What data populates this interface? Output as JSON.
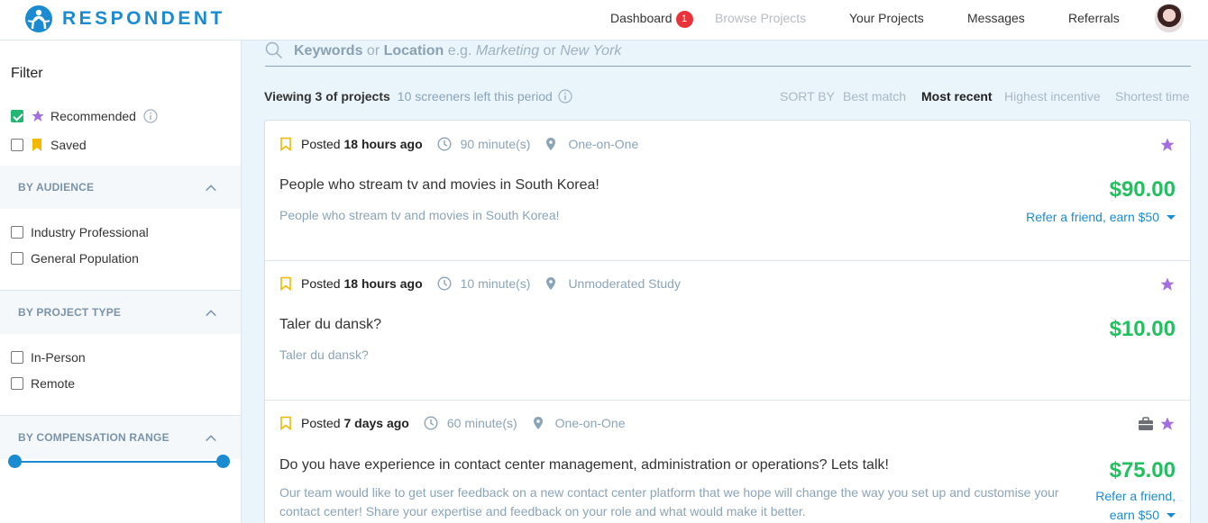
{
  "brand": {
    "name": "RESPONDENT"
  },
  "nav": {
    "dashboard": "Dashboard",
    "dashboard_badge": "1",
    "browse": "Browse Projects",
    "your_projects": "Your Projects",
    "messages": "Messages",
    "referrals": "Referrals"
  },
  "sidebar": {
    "filter_title": "Filter",
    "recommended": "Recommended",
    "saved": "Saved",
    "by_audience": "BY AUDIENCE",
    "industry_professional": "Industry Professional",
    "general_population": "General Population",
    "by_project_type": "BY PROJECT TYPE",
    "in_person": "In-Person",
    "remote": "Remote",
    "by_compensation": "BY COMPENSATION RANGE"
  },
  "search": {
    "kw": "Keywords",
    "or1": " or ",
    "loc": "Location",
    "eg": " e.g. ",
    "ex1": "Marketing",
    "or2": " or ",
    "ex2": "New York"
  },
  "listing": {
    "viewing": "Viewing 3 of projects",
    "screeners": "10 screeners left this period",
    "sort_by": "SORT BY",
    "best_match": "Best match",
    "most_recent": "Most recent",
    "highest_incentive": "Highest incentive",
    "shortest_time": "Shortest time"
  },
  "projects": [
    {
      "posted_prefix": "Posted ",
      "posted": "18 hours ago",
      "duration": "90 minute(s)",
      "type": "One-on-One",
      "title": "People who stream tv and movies in South Korea!",
      "description": "People who stream tv and movies in South Korea!",
      "price": "$90.00",
      "refer": "Refer a friend, earn $50"
    },
    {
      "posted_prefix": "Posted ",
      "posted": "18 hours ago",
      "duration": "10 minute(s)",
      "type": "Unmoderated Study",
      "title": "Taler du dansk?",
      "description": "Taler du dansk?",
      "price": "$10.00"
    },
    {
      "posted_prefix": "Posted ",
      "posted": "7 days ago",
      "duration": "60 minute(s)",
      "type": "One-on-One",
      "title": "Do you have experience in contact center management, administration or operations? Lets talk!",
      "description_line1": "Our team would like to get user feedback on a new contact center platform that we hope will change the way you set up and customise your",
      "description_line2": "contact center! Share your expertise and feedback on your role and what would make it better.",
      "price": "$75.00",
      "refer_line1": "Refer a friend,",
      "refer_line2": "earn $50"
    }
  ],
  "colors": {
    "brand_blue": "#1a8bd1",
    "price_green": "#22c05f",
    "star_purple": "#a36ee0",
    "bookmark_yellow": "#f5b800"
  }
}
